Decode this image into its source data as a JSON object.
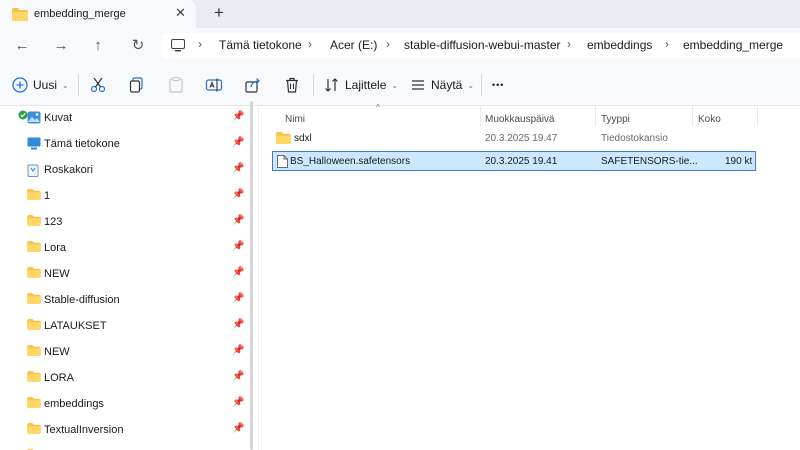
{
  "window": {
    "tab_title": "embedding_merge",
    "tab_close": "✕",
    "new_tab": "+"
  },
  "nav": {
    "back": "←",
    "forward": "→",
    "up": "↑",
    "refresh": "↻"
  },
  "breadcrumb": {
    "items": [
      "Tämä tietokone",
      "Acer (E:)",
      "stable-diffusion-webui-master",
      "embeddings",
      "embedding_merge"
    ],
    "separator": "›"
  },
  "toolbar": {
    "new_label": "Uusi",
    "sort_label": "Lajittele",
    "view_label": "Näytä",
    "more_label": "•••",
    "caret": "⌄"
  },
  "sidebar": {
    "items": [
      {
        "label": "Kuvat",
        "icon": "pictures-icon",
        "pinned": true
      },
      {
        "label": "Tämä tietokone",
        "icon": "computer-icon",
        "pinned": true
      },
      {
        "label": "Roskakori",
        "icon": "recycle-bin-icon",
        "pinned": true
      },
      {
        "label": "1",
        "icon": "folder-icon",
        "pinned": true
      },
      {
        "label": "123",
        "icon": "folder-icon",
        "pinned": true
      },
      {
        "label": "Lora",
        "icon": "folder-icon",
        "pinned": true
      },
      {
        "label": "NEW",
        "icon": "folder-icon",
        "pinned": true
      },
      {
        "label": "Stable-diffusion",
        "icon": "folder-icon",
        "pinned": true
      },
      {
        "label": "LATAUKSET",
        "icon": "folder-icon",
        "pinned": true
      },
      {
        "label": "NEW",
        "icon": "folder-icon",
        "pinned": true
      },
      {
        "label": "LORA",
        "icon": "folder-icon",
        "pinned": true
      },
      {
        "label": "embeddings",
        "icon": "folder-icon",
        "pinned": true
      },
      {
        "label": "TextualInversion",
        "icon": "folder-icon",
        "pinned": true
      }
    ],
    "pin_glyph": "📌"
  },
  "list": {
    "columns": [
      "Nimi",
      "Muokkauspäivä",
      "Tyyppi",
      "Koko"
    ],
    "sort_indicator": "^",
    "rows": [
      {
        "name": "sdxl",
        "modified": "20.3.2025 19.47",
        "type": "Tiedostokansio",
        "size": "",
        "icon": "folder-icon",
        "selected": false
      },
      {
        "name": "BS_Halloween.safetensors",
        "modified": "20.3.2025 19.41",
        "type": "SAFETENSORS-tie...",
        "size": "190 kt",
        "icon": "file-icon",
        "selected": true
      }
    ]
  },
  "colors": {
    "folder": "#f7c44a",
    "selection": "#cce8ff",
    "selection_border": "#3b7ad8",
    "chrome": "#f7f9fc"
  }
}
